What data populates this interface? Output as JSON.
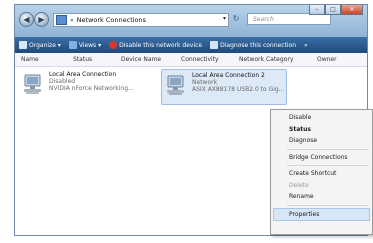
{
  "titlebar": {
    "back_glyph": "◀",
    "forward_glyph": "▶",
    "address_sep": "«",
    "address_text": "Network Connections",
    "address_drop": "▾",
    "refresh_glyph": "↻",
    "search_placeholder": "Search",
    "minimize": "–",
    "maximize": "□",
    "close": "✕"
  },
  "toolbar": {
    "organize": "Organize ▾",
    "views": "Views ▾",
    "disable": "Disable this network device",
    "diagnose": "Diagnose this connection",
    "more": "»"
  },
  "columns": {
    "name": "Name",
    "status": "Status",
    "device_name": "Device Name",
    "connectivity": "Connectivity",
    "network_category": "Network Category",
    "owner": "Owner"
  },
  "connections": [
    {
      "name": "Local Area Connection",
      "status": "Disabled",
      "device": "NVIDIA nForce Networking..."
    },
    {
      "name": "Local Area Connection 2",
      "status": "Network",
      "device": "ASIX AX88178 USB2.0 to Gig..."
    }
  ],
  "context_menu": {
    "disable": "Disable",
    "status": "Status",
    "diagnose": "Diagnose",
    "bridge": "Bridge Connections",
    "create_shortcut": "Create Shortcut",
    "delete": "Delete",
    "rename": "Rename",
    "properties": "Properties"
  },
  "colors": {
    "toolbar": "#2c5a8c",
    "selection": "#dce9f7",
    "close_button": "#c9472d"
  }
}
